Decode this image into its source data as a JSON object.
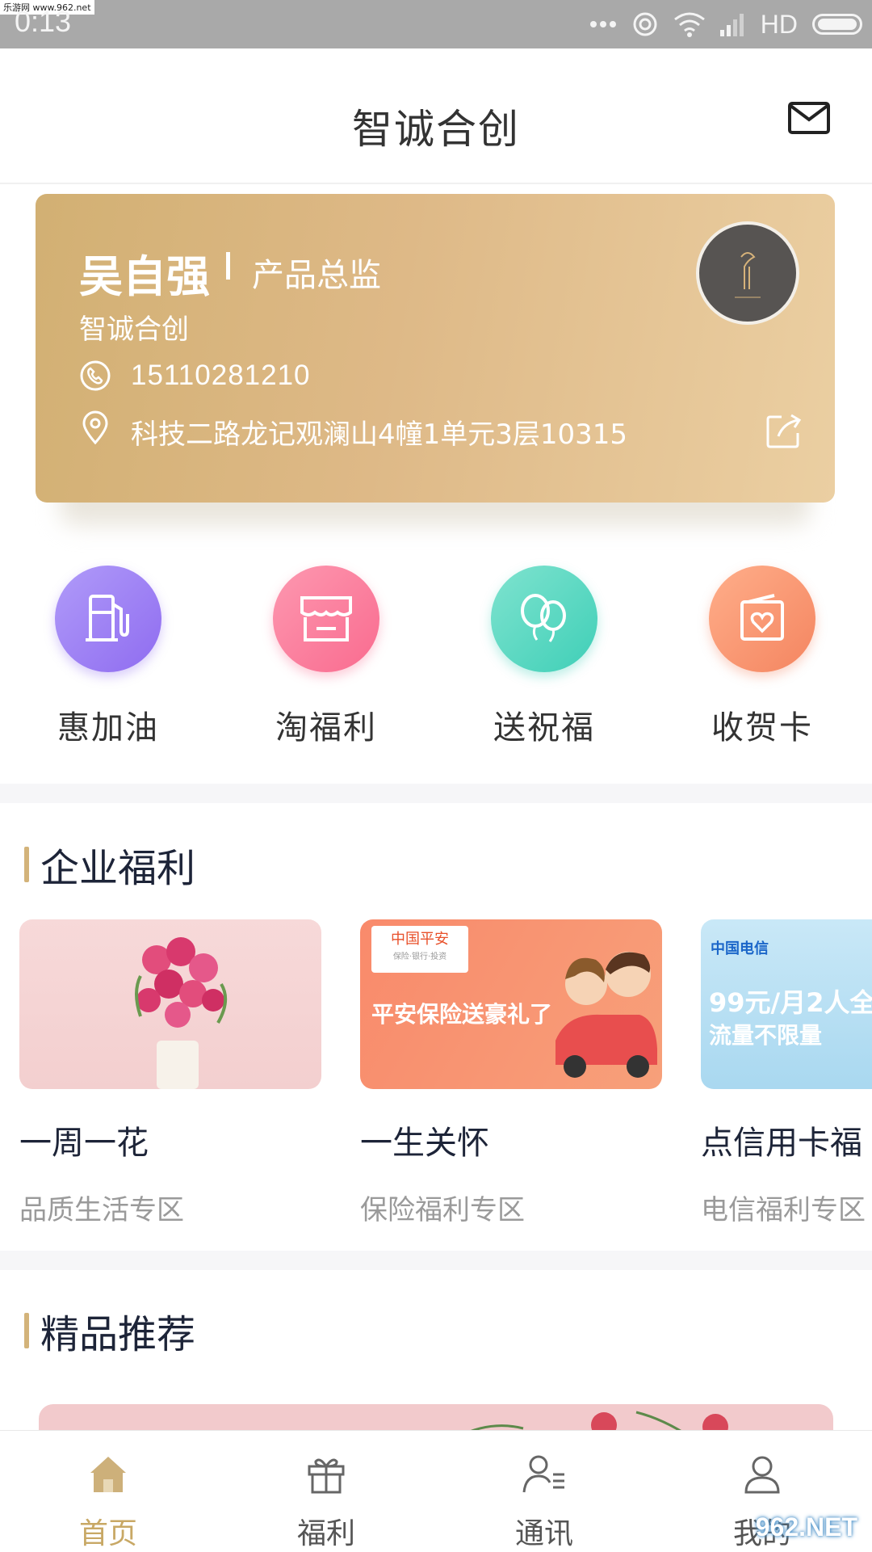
{
  "status_bar": {
    "time": "0:13",
    "network": "HD",
    "watermark": "乐游网 www.962.net"
  },
  "header": {
    "title": "智诚合创",
    "icon": "mail-icon"
  },
  "card": {
    "name": "吴自强",
    "role": "产品总监",
    "company": "智诚合创",
    "phone": "15110281210",
    "address": "科技二路龙记观澜山4幢1单元3层10315",
    "accent_color": "#d2b073"
  },
  "quick_actions": [
    {
      "label": "惠加油",
      "icon": "fuel-pump-icon",
      "color": "#9d80f4"
    },
    {
      "label": "淘福利",
      "icon": "storefront-icon",
      "color": "#fb7f9c"
    },
    {
      "label": "送祝福",
      "icon": "balloons-icon",
      "color": "#52d7c0"
    },
    {
      "label": "收贺卡",
      "icon": "card-heart-icon",
      "color": "#f7936f"
    }
  ],
  "sections": {
    "welfare_title": "企业福利",
    "recommend_title": "精品推荐"
  },
  "welfare_items": [
    {
      "title": "一周一花",
      "subtitle": "品质生活专区"
    },
    {
      "title": "一生关怀",
      "subtitle": "保险福利专区",
      "image_brand": "中国平安",
      "image_brand_sub": "保险·银行·投资",
      "image_text": "平安保险送豪礼了"
    },
    {
      "title": "点信用卡福",
      "subtitle": "电信福利专区",
      "image_brand": "中国电信",
      "image_text1": "99元/月2人全",
      "image_text2": "流量不限量"
    }
  ],
  "bottom_nav": [
    {
      "label": "首页",
      "active": true
    },
    {
      "label": "福利",
      "active": false
    },
    {
      "label": "通讯",
      "active": false
    },
    {
      "label": "我的",
      "active": false
    }
  ],
  "watermark_bottom": "962.NET"
}
